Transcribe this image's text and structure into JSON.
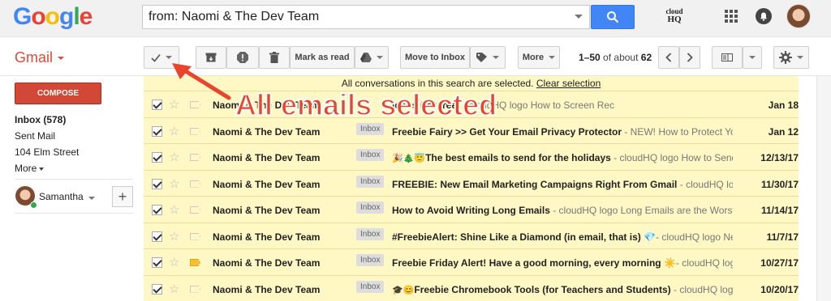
{
  "header": {
    "logo_letters": [
      {
        "ch": "G",
        "color": "#4285f4"
      },
      {
        "ch": "o",
        "color": "#ea4335"
      },
      {
        "ch": "o",
        "color": "#fbbc05"
      },
      {
        "ch": "g",
        "color": "#4285f4"
      },
      {
        "ch": "l",
        "color": "#34a853"
      },
      {
        "ch": "e",
        "color": "#ea4335"
      }
    ],
    "search_value": "from: Naomi & The Dev Team",
    "cloudhq_top": "cloud",
    "cloudhq_bottom": "HQ"
  },
  "toolbar": {
    "gmail_label": "Gmail",
    "mark_as_read": "Mark as read",
    "move_to_inbox": "Move to Inbox",
    "more": "More",
    "pager_range": "1–50",
    "pager_of": "of about",
    "pager_total": "62"
  },
  "sidebar": {
    "compose": "COMPOSE",
    "items": [
      "Inbox (578)",
      "Sent Mail",
      "104 Elm Street",
      "More"
    ],
    "user": "Samantha",
    "add": "+"
  },
  "banner": {
    "text": "All conversations in this search are selected.",
    "link": "Clear selection"
  },
  "annotation": "All emails selected",
  "emails": [
    {
      "sender": "Naomi & The Dev Team",
      "label": "",
      "prefix": "",
      "subject": "ideos (for free)",
      "snippet": " - cloudHQ logo How to Screen Rec",
      "date": "Jan 18",
      "important": false
    },
    {
      "sender": "Naomi & The Dev Team",
      "label": "Inbox",
      "prefix": "",
      "subject": "Freebie Fairy >> Get Your Email Privacy Protector",
      "snippet": " - NEW! How to Protect Yo",
      "date": "Jan 12",
      "important": false
    },
    {
      "sender": "Naomi & The Dev Team",
      "label": "Inbox",
      "prefix": "🎉🎄😇",
      "subject": "The best emails to send for the holidays",
      "snippet": " - cloudHQ logo How to Send",
      "date": "12/13/17",
      "important": false
    },
    {
      "sender": "Naomi & The Dev Team",
      "label": "Inbox",
      "prefix": "",
      "subject": "FREEBIE: New Email Marketing Campaigns Right From Gmail",
      "snippet": " - cloudHQ lo",
      "date": "11/30/17",
      "important": false
    },
    {
      "sender": "Naomi & The Dev Team",
      "label": "Inbox",
      "prefix": "",
      "subject": "How to Avoid Writing Long Emails",
      "snippet": " - cloudHQ logo Long Emails are the Worst",
      "date": "11/14/17",
      "important": false
    },
    {
      "sender": "Naomi & The Dev Team",
      "label": "Inbox",
      "prefix": "",
      "subject": "#FreebieAlert: Shine Like a Diamond (in email, that is) 💎",
      "snippet": "- cloudHQ logo Ne",
      "date": "11/7/17",
      "important": false
    },
    {
      "sender": "Naomi & The Dev Team",
      "label": "Inbox",
      "prefix": "",
      "subject": "Freebie Friday Alert! Have a good morning, every morning ☀️",
      "snippet": "- cloudHQ log",
      "date": "10/27/17",
      "important": true
    },
    {
      "sender": "Naomi & The Dev Team",
      "label": "Inbox",
      "prefix": "🎓😊",
      "subject": "Freebie Chromebook Tools (for Teachers and Students)",
      "snippet": " - cloudHQ logo",
      "date": "10/20/17",
      "important": false
    }
  ]
}
